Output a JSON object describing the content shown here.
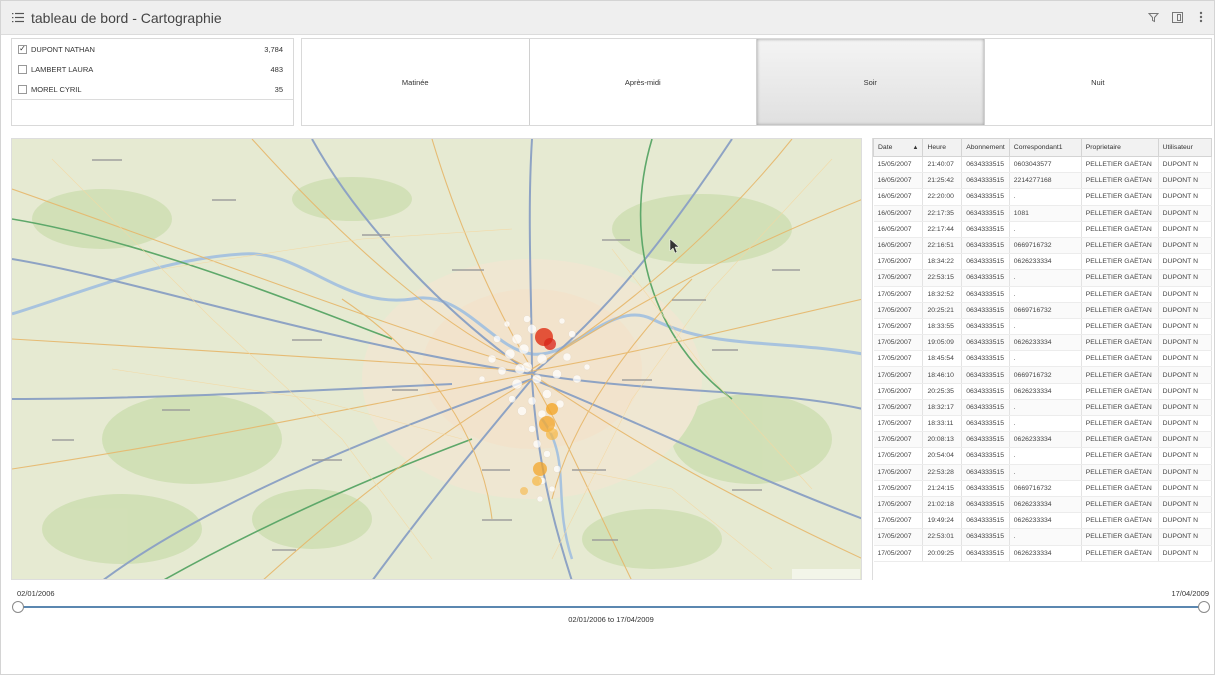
{
  "header": {
    "title": "tableau de bord - Cartographie"
  },
  "filter": {
    "items": [
      {
        "name": "DUPONT NATHAN",
        "count": "3,784",
        "checked": "✓"
      },
      {
        "name": "LAMBERT LAURA",
        "count": "483",
        "checked": ""
      },
      {
        "name": "MOREL CYRIL",
        "count": "35",
        "checked": ""
      }
    ]
  },
  "periods": {
    "items": [
      "Matinée",
      "Après-midi",
      "Soir",
      "Nuit"
    ],
    "active": "Soir"
  },
  "table": {
    "columns": [
      "Date",
      "Heure",
      "Abonnement",
      "Correspondant1",
      "Proprietaire",
      "Utilisateur"
    ],
    "rows": [
      [
        "15/05/2007",
        "21:40:07",
        "0634333515",
        "0603043577",
        "PELLETIER GAËTAN",
        "DUPONT N"
      ],
      [
        "16/05/2007",
        "21:25:42",
        "0634333515",
        "2214277168",
        "PELLETIER GAËTAN",
        "DUPONT N"
      ],
      [
        "16/05/2007",
        "22:20:00",
        "0634333515",
        ".",
        "PELLETIER GAËTAN",
        "DUPONT N"
      ],
      [
        "16/05/2007",
        "22:17:35",
        "0634333515",
        "1081",
        "PELLETIER GAËTAN",
        "DUPONT N"
      ],
      [
        "16/05/2007",
        "22:17:44",
        "0634333515",
        ".",
        "PELLETIER GAËTAN",
        "DUPONT N"
      ],
      [
        "16/05/2007",
        "22:16:51",
        "0634333515",
        "0669716732",
        "PELLETIER GAËTAN",
        "DUPONT N"
      ],
      [
        "17/05/2007",
        "18:34:22",
        "0634333515",
        "0626233334",
        "PELLETIER GAËTAN",
        "DUPONT N"
      ],
      [
        "17/05/2007",
        "22:53:15",
        "0634333515",
        ".",
        "PELLETIER GAËTAN",
        "DUPONT N"
      ],
      [
        "17/05/2007",
        "18:32:52",
        "0634333515",
        ".",
        "PELLETIER GAËTAN",
        "DUPONT N"
      ],
      [
        "17/05/2007",
        "20:25:21",
        "0634333515",
        "0669716732",
        "PELLETIER GAËTAN",
        "DUPONT N"
      ],
      [
        "17/05/2007",
        "18:33:55",
        "0634333515",
        ".",
        "PELLETIER GAËTAN",
        "DUPONT N"
      ],
      [
        "17/05/2007",
        "19:05:09",
        "0634333515",
        "0626233334",
        "PELLETIER GAËTAN",
        "DUPONT N"
      ],
      [
        "17/05/2007",
        "18:45:54",
        "0634333515",
        ".",
        "PELLETIER GAËTAN",
        "DUPONT N"
      ],
      [
        "17/05/2007",
        "18:46:10",
        "0634333515",
        "0669716732",
        "PELLETIER GAËTAN",
        "DUPONT N"
      ],
      [
        "17/05/2007",
        "20:25:35",
        "0634333515",
        "0626233334",
        "PELLETIER GAËTAN",
        "DUPONT N"
      ],
      [
        "17/05/2007",
        "18:32:17",
        "0634333515",
        ".",
        "PELLETIER GAËTAN",
        "DUPONT N"
      ],
      [
        "17/05/2007",
        "18:33:11",
        "0634333515",
        ".",
        "PELLETIER GAËTAN",
        "DUPONT N"
      ],
      [
        "17/05/2007",
        "20:08:13",
        "0634333515",
        "0626233334",
        "PELLETIER GAËTAN",
        "DUPONT N"
      ],
      [
        "17/05/2007",
        "20:54:04",
        "0634333515",
        ".",
        "PELLETIER GAËTAN",
        "DUPONT N"
      ],
      [
        "17/05/2007",
        "22:53:28",
        "0634333515",
        ".",
        "PELLETIER GAËTAN",
        "DUPONT N"
      ],
      [
        "17/05/2007",
        "21:24:15",
        "0634333515",
        "0669716732",
        "PELLETIER GAËTAN",
        "DUPONT N"
      ],
      [
        "17/05/2007",
        "21:02:18",
        "0634333515",
        "0626233334",
        "PELLETIER GAËTAN",
        "DUPONT N"
      ],
      [
        "17/05/2007",
        "19:49:24",
        "0634333515",
        "0626233334",
        "PELLETIER GAËTAN",
        "DUPONT N"
      ],
      [
        "17/05/2007",
        "22:53:01",
        "0634333515",
        ".",
        "PELLETIER GAËTAN",
        "DUPONT N"
      ],
      [
        "17/05/2007",
        "20:09:25",
        "0634333515",
        "0626233334",
        "PELLETIER GAËTAN",
        "DUPONT N"
      ]
    ]
  },
  "slider": {
    "start": "02/01/2006",
    "end": "17/04/2009",
    "range_label": "02/01/2006 to 17/04/2009"
  },
  "icons": {
    "menu": "list-icon",
    "filter": "filter-icon",
    "panel": "panel-icon",
    "more": "more-vertical-icon"
  },
  "colors": {
    "track": "#5b87b0",
    "hotspot_red": "#e03a1e",
    "hotspot_orange": "#f3a62a"
  }
}
